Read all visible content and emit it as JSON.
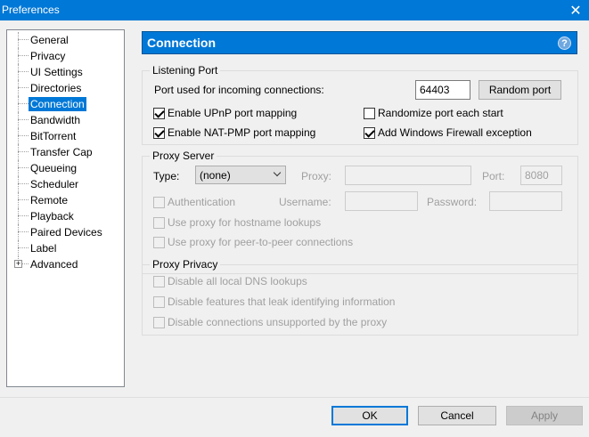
{
  "window": {
    "title": "Preferences",
    "close_glyph": "✕"
  },
  "tree": {
    "items": [
      {
        "label": "General"
      },
      {
        "label": "Privacy"
      },
      {
        "label": "UI Settings"
      },
      {
        "label": "Directories"
      },
      {
        "label": "Connection"
      },
      {
        "label": "Bandwidth"
      },
      {
        "label": "BitTorrent"
      },
      {
        "label": "Transfer Cap"
      },
      {
        "label": "Queueing"
      },
      {
        "label": "Scheduler"
      },
      {
        "label": "Remote"
      },
      {
        "label": "Playback"
      },
      {
        "label": "Paired Devices"
      },
      {
        "label": "Label"
      },
      {
        "label": "Advanced",
        "expander": "+"
      }
    ],
    "selected": "Connection"
  },
  "header": {
    "title": "Connection",
    "help_glyph": "?"
  },
  "listening_port": {
    "title": "Listening Port",
    "port_label": "Port used for incoming connections:",
    "port_value": "64403",
    "random_port_button": "Random port",
    "upnp": {
      "label": "Enable UPnP port mapping",
      "checked": true
    },
    "natpmp": {
      "label": "Enable NAT-PMP port mapping",
      "checked": true
    },
    "randomize": {
      "label": "Randomize port each start",
      "checked": false
    },
    "firewall": {
      "label": "Add Windows Firewall exception",
      "checked": true
    }
  },
  "proxy_server": {
    "title": "Proxy Server",
    "type_label": "Type:",
    "type_value": "(none)",
    "proxy_label": "Proxy:",
    "proxy_value": "",
    "port_label": "Port:",
    "port_value": "8080",
    "auth_label": "Authentication",
    "username_label": "Username:",
    "password_label": "Password:",
    "hostname_lookups_label": "Use proxy for hostname lookups",
    "p2p_label": "Use proxy for peer-to-peer connections"
  },
  "proxy_privacy": {
    "title": "Proxy Privacy",
    "dns_label": "Disable all local DNS lookups",
    "leak_label": "Disable features that leak identifying information",
    "unsupported_label": "Disable connections unsupported by the proxy"
  },
  "footer": {
    "ok": "OK",
    "cancel": "Cancel",
    "apply": "Apply"
  },
  "colors": {
    "accent": "#0078d7",
    "background": "#f0f0f0"
  }
}
